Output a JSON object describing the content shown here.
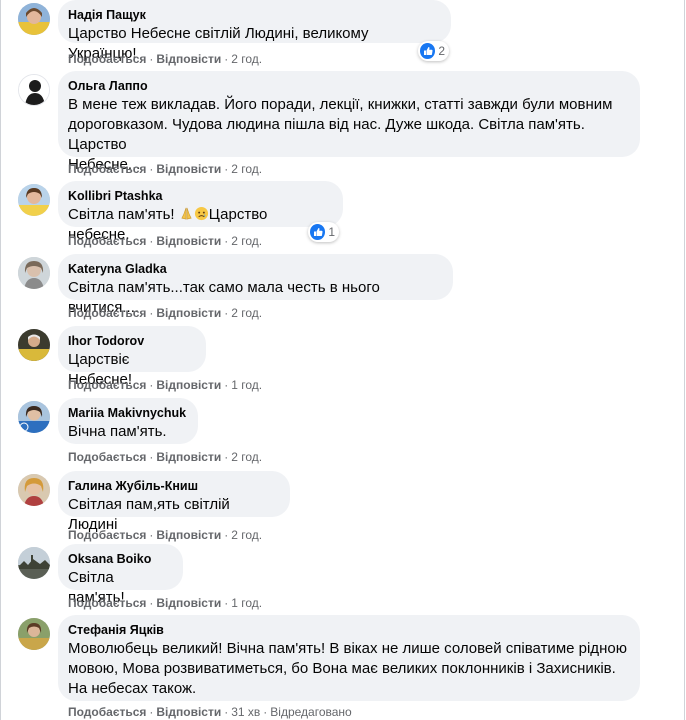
{
  "actions": {
    "like_label": "Подобається",
    "reply_label": "Відповісти",
    "separator": "·"
  },
  "comments": [
    {
      "author": "Надія Пащук",
      "text": "Царство Небесне світлій Людині, великому Українцю!",
      "time": "2 год.",
      "reaction_icon": "like-icon",
      "reaction_count": "2"
    },
    {
      "author": "Ольга Лаппо",
      "text_lines": [
        "В мене теж викладав. Його поради, лекції, книжки, статті завжди були мовним",
        "дороговказом. Чудова людина пішла від нас. Дуже шкода. Світла пам'ять. Царство",
        "Небесне..."
      ],
      "time": "2 год."
    },
    {
      "author": "Kollibri Ptashka",
      "text_before": "Світла пам'ять! ",
      "emoji_icons": [
        "folded-hands-icon",
        "sad-face-icon"
      ],
      "text_after": "Царство небесне.",
      "time": "2 год.",
      "reaction_icon": "like-icon",
      "reaction_count": "1"
    },
    {
      "author": "Kateryna Gladka",
      "text": "Світла пам'ять...так само мала честь в нього вчитися....",
      "time": "2 год."
    },
    {
      "author": "Ihor Todorov",
      "text": "Царствіє Небесне!",
      "time": "1 год."
    },
    {
      "author": "Mariia Makivnychuk",
      "text": "Вічна пам'ять.",
      "time": "2 год."
    },
    {
      "author": "Галина Жубіль-Книш",
      "text": "Світлая пам,ять світлій Людині",
      "time": "2 год."
    },
    {
      "author": "Oksana Boiko",
      "text": "Світла пам'ять!",
      "time": "1 год."
    },
    {
      "author": "Стефанія Яцків",
      "text_lines": [
        "Моволюбець великий! Вічна пам'ять! В віках не лише соловей співатиме рідною",
        "мовою, Мова розвиватиметься, бо Вона має великих поклонників і Захисників.",
        "На небесах також."
      ],
      "time": "31 хв",
      "edited": "Відредаговано"
    }
  ],
  "colors": {
    "bubble": "#f0f2f5",
    "meta": "#65676b",
    "like_blue": "#1877f2"
  }
}
